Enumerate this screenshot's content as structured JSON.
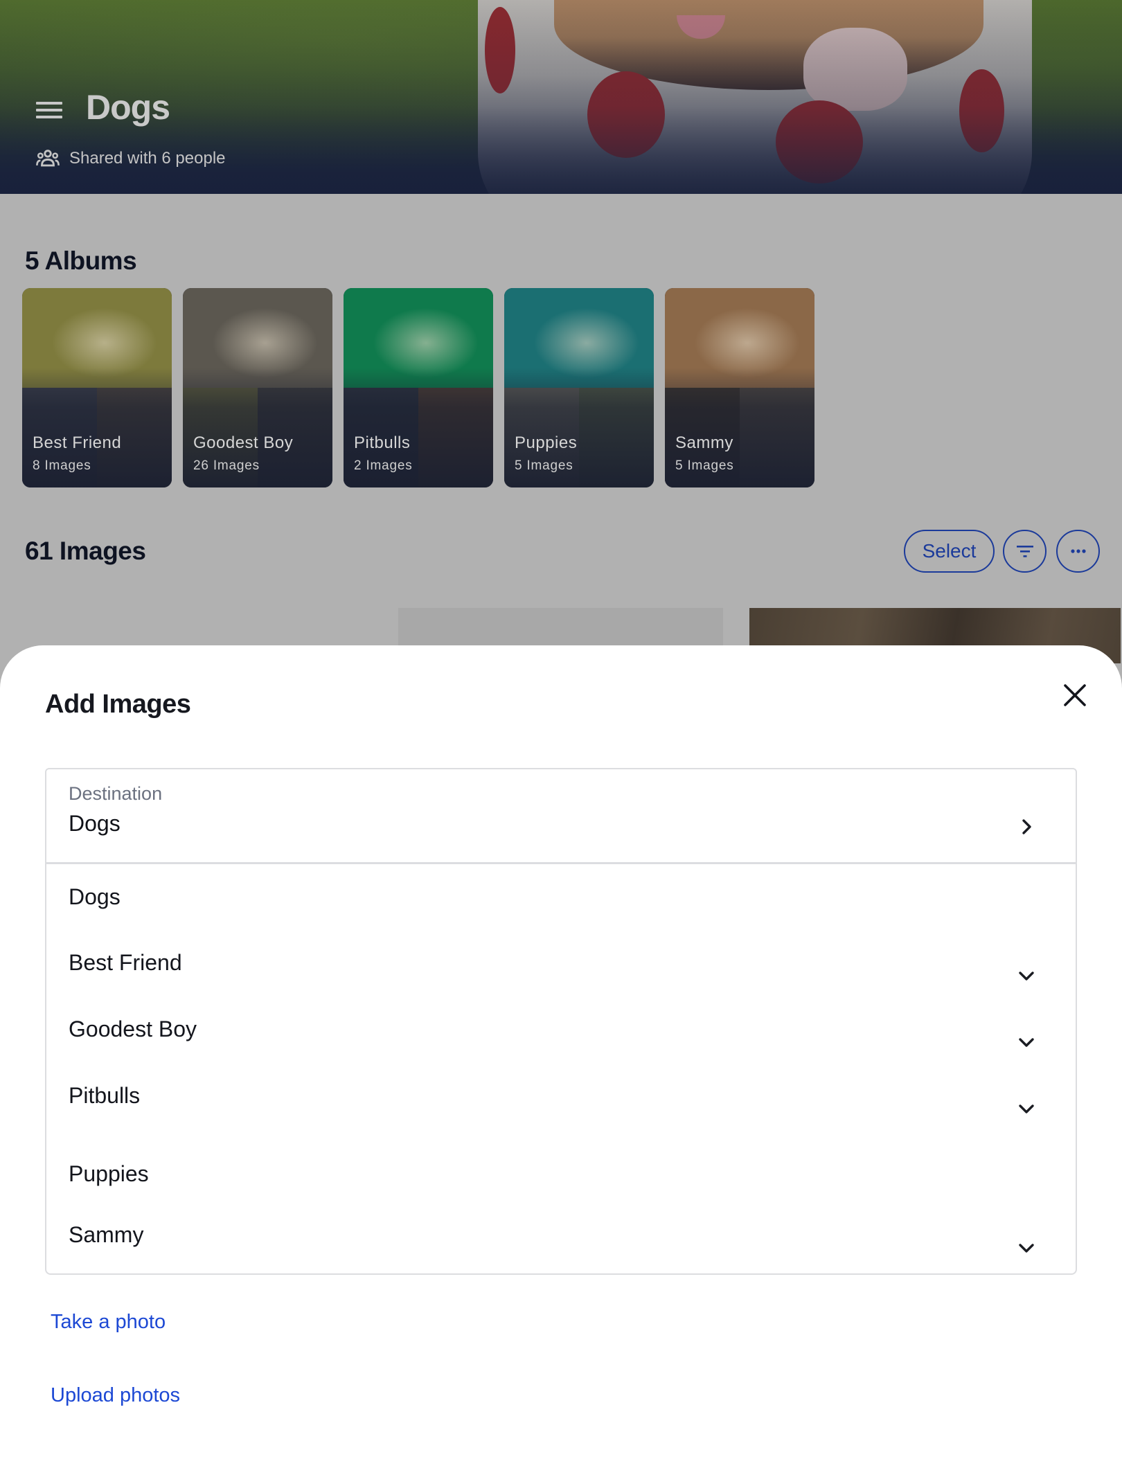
{
  "header": {
    "title": "Dogs",
    "shared_text": "Shared with 6 people",
    "menu_icon": "hamburger-menu-icon",
    "people_icon": "group-icon"
  },
  "albums_section": {
    "title": "5 Albums",
    "albums": [
      {
        "name": "Best Friend",
        "count": "8 Images",
        "colors": {
          "top": "#7d7a3c",
          "bl": "#3a3e4a",
          "br": "#4a4440"
        }
      },
      {
        "name": "Goodest Boy",
        "count": "26 Images",
        "colors": {
          "top": "#5b574f",
          "bl": "#5a5a3d",
          "br": "#3c3c3e"
        }
      },
      {
        "name": "Pitbulls",
        "count": "2 Images",
        "colors": {
          "top": "#0f7a4c",
          "bl": "#2d3340",
          "br": "#4b3d36"
        }
      },
      {
        "name": "Puppies",
        "count": "5 Images",
        "colors": {
          "top": "#1b6f72",
          "bl": "#5a5a55",
          "br": "#4c5545"
        }
      },
      {
        "name": "Sammy",
        "count": "5 Images",
        "colors": {
          "top": "#8b6848",
          "bl": "#3b3530",
          "br": "#4d4742"
        }
      }
    ]
  },
  "images_section": {
    "title": "61 Images",
    "select_label": "Select",
    "filter_icon": "filter-icon",
    "more_icon": "more-horizontal-icon",
    "accent_color": "#1b3a9a"
  },
  "sheet": {
    "title": "Add Images",
    "close_icon": "close-icon",
    "destination": {
      "label": "Destination",
      "value": "Dogs"
    },
    "folders": [
      {
        "label": "Dogs",
        "expandable": false
      },
      {
        "label": "Best Friend",
        "expandable": true
      },
      {
        "label": "Goodest Boy",
        "expandable": true
      },
      {
        "label": "Pitbulls",
        "expandable": true
      },
      {
        "label": "Puppies",
        "expandable": false
      },
      {
        "label": "Sammy",
        "expandable": true
      }
    ],
    "take_photo_label": "Take a photo",
    "upload_label": "Upload photos",
    "link_color": "#1c48d4"
  }
}
